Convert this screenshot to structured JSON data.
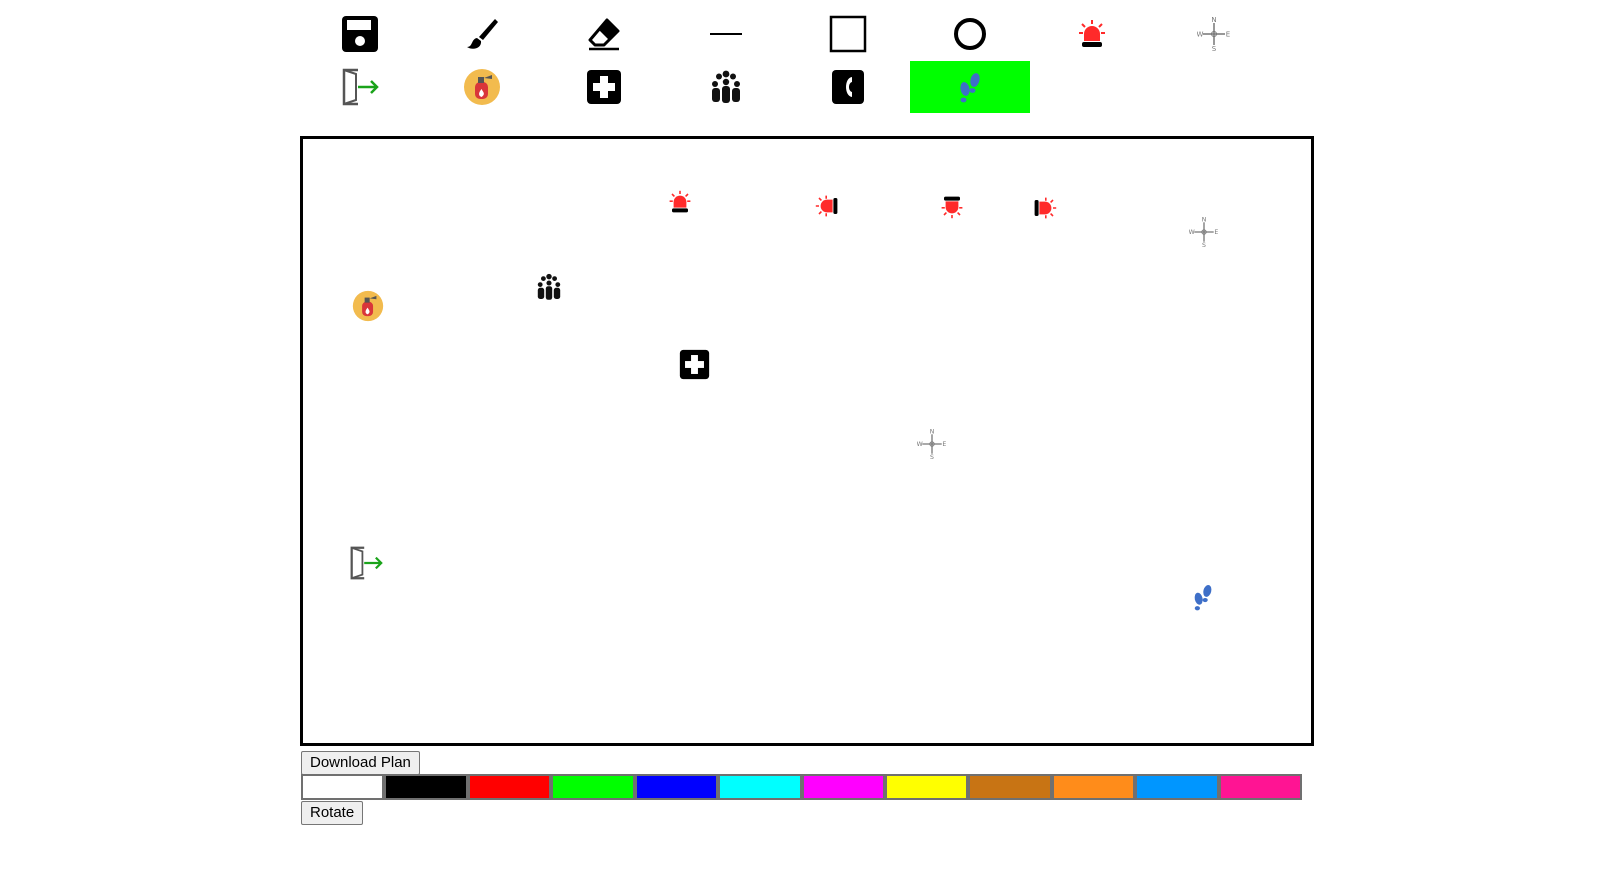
{
  "toolbar": {
    "row1": [
      {
        "name": "save-tool",
        "icon": "save-icon"
      },
      {
        "name": "brush-tool",
        "icon": "brush-icon"
      },
      {
        "name": "eraser-tool",
        "icon": "eraser-icon"
      },
      {
        "name": "line-tool",
        "icon": "line-icon"
      },
      {
        "name": "rectangle-tool",
        "icon": "rectangle-icon"
      },
      {
        "name": "circle-tool",
        "icon": "circle-icon"
      },
      {
        "name": "alarm-tool",
        "icon": "alarm-siren-icon"
      },
      {
        "name": "compass-tool",
        "icon": "compass-icon"
      }
    ],
    "row2": [
      {
        "name": "exit-tool",
        "icon": "exit-door-icon"
      },
      {
        "name": "extinguisher-tool",
        "icon": "fire-extinguisher-icon"
      },
      {
        "name": "first-aid-tool",
        "icon": "first-aid-icon"
      },
      {
        "name": "assembly-point-tool",
        "icon": "people-group-icon"
      },
      {
        "name": "phone-tool",
        "icon": "phone-icon"
      },
      {
        "name": "footsteps-tool",
        "icon": "footsteps-icon",
        "active": true
      }
    ],
    "active_color": "#00ff00"
  },
  "canvas": {
    "placed_icons": [
      {
        "icon": "alarm-siren-icon",
        "rotation": "0"
      },
      {
        "icon": "alarm-siren-icon",
        "rotation": "90"
      },
      {
        "icon": "alarm-siren-icon",
        "rotation": "180"
      },
      {
        "icon": "alarm-siren-icon",
        "rotation": "270"
      },
      {
        "icon": "compass-icon"
      },
      {
        "icon": "people-group-icon"
      },
      {
        "icon": "fire-extinguisher-icon"
      },
      {
        "icon": "first-aid-icon"
      },
      {
        "icon": "compass-icon"
      },
      {
        "icon": "exit-door-icon"
      },
      {
        "icon": "footsteps-icon"
      }
    ]
  },
  "controls": {
    "download_label": "Download Plan",
    "rotate_label": "Rotate"
  },
  "palette": {
    "colors": [
      "#ffffff",
      "#000000",
      "#ff0000",
      "#00ff00",
      "#0000ff",
      "#00ffff",
      "#ff00ff",
      "#ffff00",
      "#c87414",
      "#ff8c1a",
      "#0096ff",
      "#ff1493"
    ]
  }
}
